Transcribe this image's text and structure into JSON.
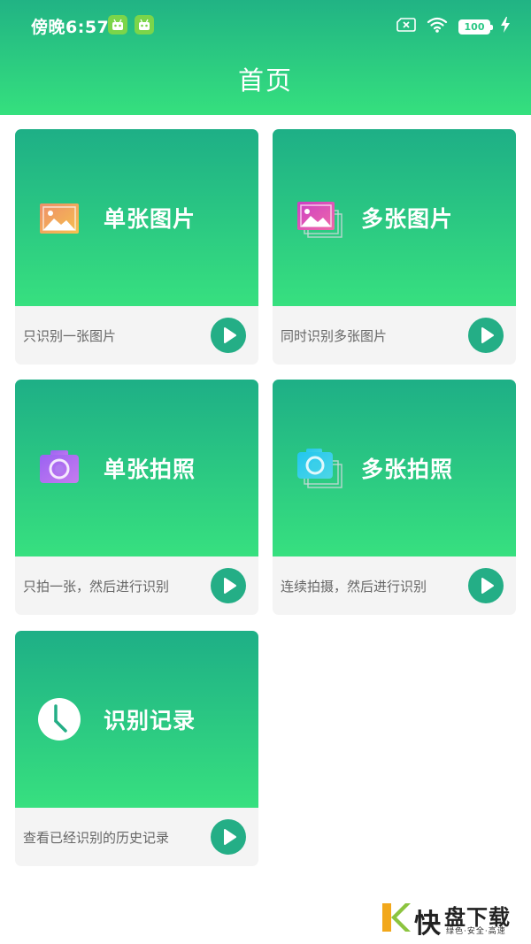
{
  "status_bar": {
    "time": "傍晚6:57",
    "battery": "100",
    "icons": [
      "android-robot-icon",
      "android-robot-icon",
      "sim-x-icon",
      "wifi-icon",
      "battery-icon",
      "charging-icon"
    ]
  },
  "header": {
    "title": "首页"
  },
  "cards": [
    {
      "title": "单张图片",
      "desc": "只识别一张图片",
      "icon": "image-icon",
      "icon_color": "#f2a15f"
    },
    {
      "title": "多张图片",
      "desc": "同时识别多张图片",
      "icon": "multi-image-icon",
      "icon_color": "#e052c3"
    },
    {
      "title": "单张拍照",
      "desc": "只拍一张，然后进行识别",
      "icon": "camera-icon",
      "icon_color": "#a86af0"
    },
    {
      "title": "多张拍照",
      "desc": "连续拍摄，然后进行识别",
      "icon": "multi-camera-icon",
      "icon_color": "#2fc9e6"
    },
    {
      "title": "识别记录",
      "desc": "查看已经识别的历史记录",
      "icon": "clock-icon",
      "icon_color": "#ffffff"
    }
  ],
  "watermark": {
    "kuai": "快",
    "name": "盘下载",
    "tagline": "绿色·安全·高速"
  },
  "colors": {
    "primary": "#24ae86",
    "accent_green": "#37e07f"
  }
}
